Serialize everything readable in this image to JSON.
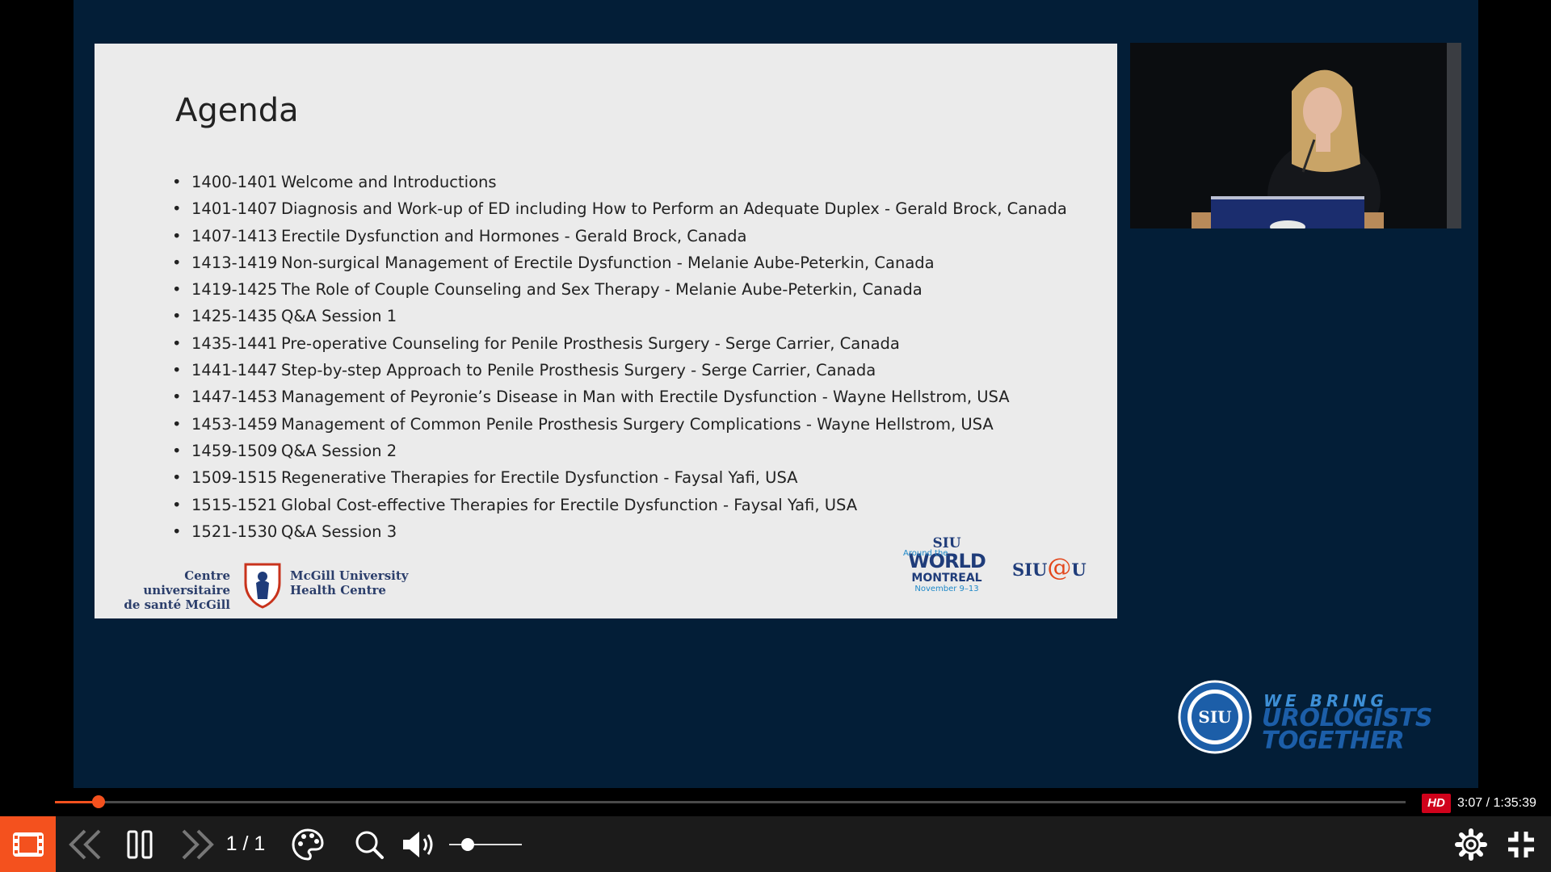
{
  "slide": {
    "title": "Agenda",
    "agenda": [
      {
        "time": "1400-1401",
        "topic": "Welcome and Introductions"
      },
      {
        "time": "1401-1407",
        "topic": "Diagnosis and Work-up of ED including How to Perform an Adequate Duplex - Gerald Brock, Canada"
      },
      {
        "time": "1407-1413",
        "topic": "Erectile Dysfunction and Hormones - Gerald Brock, Canada"
      },
      {
        "time": "1413-1419",
        "topic": "Non-surgical Management of Erectile Dysfunction  - Melanie Aube-Peterkin, Canada"
      },
      {
        "time": "1419-1425",
        "topic": "The Role of Couple Counseling and Sex Therapy - Melanie Aube-Peterkin, Canada"
      },
      {
        "time": "1425-1435",
        "topic": "Q&A Session 1"
      },
      {
        "time": "1435-1441",
        "topic": "Pre-operative Counseling for Penile Prosthesis Surgery - Serge Carrier, Canada"
      },
      {
        "time": "1441-1447",
        "topic": "Step-by-step Approach to Penile Prosthesis Surgery - Serge Carrier, Canada"
      },
      {
        "time": "1447-1453",
        "topic": "Management of Peyronie’s Disease in Man with Erectile Dysfunction - Wayne Hellstrom, USA"
      },
      {
        "time": "1453-1459",
        "topic": "Management of Common Penile Prosthesis Surgery Complications - Wayne Hellstrom, USA"
      },
      {
        "time": "1459-1509",
        "topic": "Q&A Session 2"
      },
      {
        "time": "1509-1515",
        "topic": "Regenerative Therapies for Erectile Dysfunction - Faysal Yafi, USA"
      },
      {
        "time": "1515-1521",
        "topic": "Global Cost-effective Therapies for Erectile Dysfunction - Faysal Yafi, USA"
      },
      {
        "time": "1521-1530",
        "topic": "Q&A Session 3"
      }
    ],
    "logos": {
      "cusm_left_line1": "Centre universitaire",
      "cusm_left_line2": "de santé McGill",
      "cusm_right_line1": "McGill University",
      "cusm_right_line2": "Health Centre",
      "siu_world_line1": "SIU",
      "siu_world_around": "Around the",
      "siu_world_line2": "WORLD",
      "siu_world_line3": "MONTREAL",
      "siu_world_line4": "November 9–13",
      "siu_at_u_prefix": "SIU",
      "siu_at_u_at": "@",
      "siu_at_u_suffix": "U"
    }
  },
  "branding": {
    "seal_text": "SIU",
    "tagline_line1": "WE BRING",
    "tagline_line2": "UROLOGISTS",
    "tagline_line3": "TOGETHER"
  },
  "player": {
    "progress_fraction": 0.032,
    "hd_label": "HD",
    "time_display": "3:07 / 1:35:39",
    "page_indicator": "1 / 1",
    "volume_fraction": 0.25
  },
  "icons": {
    "chapters": "film-strip-icon",
    "previous": "double-chevron-left-icon",
    "pause": "pause-icon",
    "next": "double-chevron-right-icon",
    "palette": "palette-icon",
    "zoom": "magnifier-icon",
    "volume": "speaker-icon",
    "settings": "gear-icon",
    "fullscreen_exit": "compress-icon"
  },
  "colors": {
    "stage_background": "#031e37",
    "slide_background": "#ebebeb",
    "accent": "#f4511e",
    "hd_badge": "#d0021b",
    "control_bar": "#1b1b1b"
  }
}
